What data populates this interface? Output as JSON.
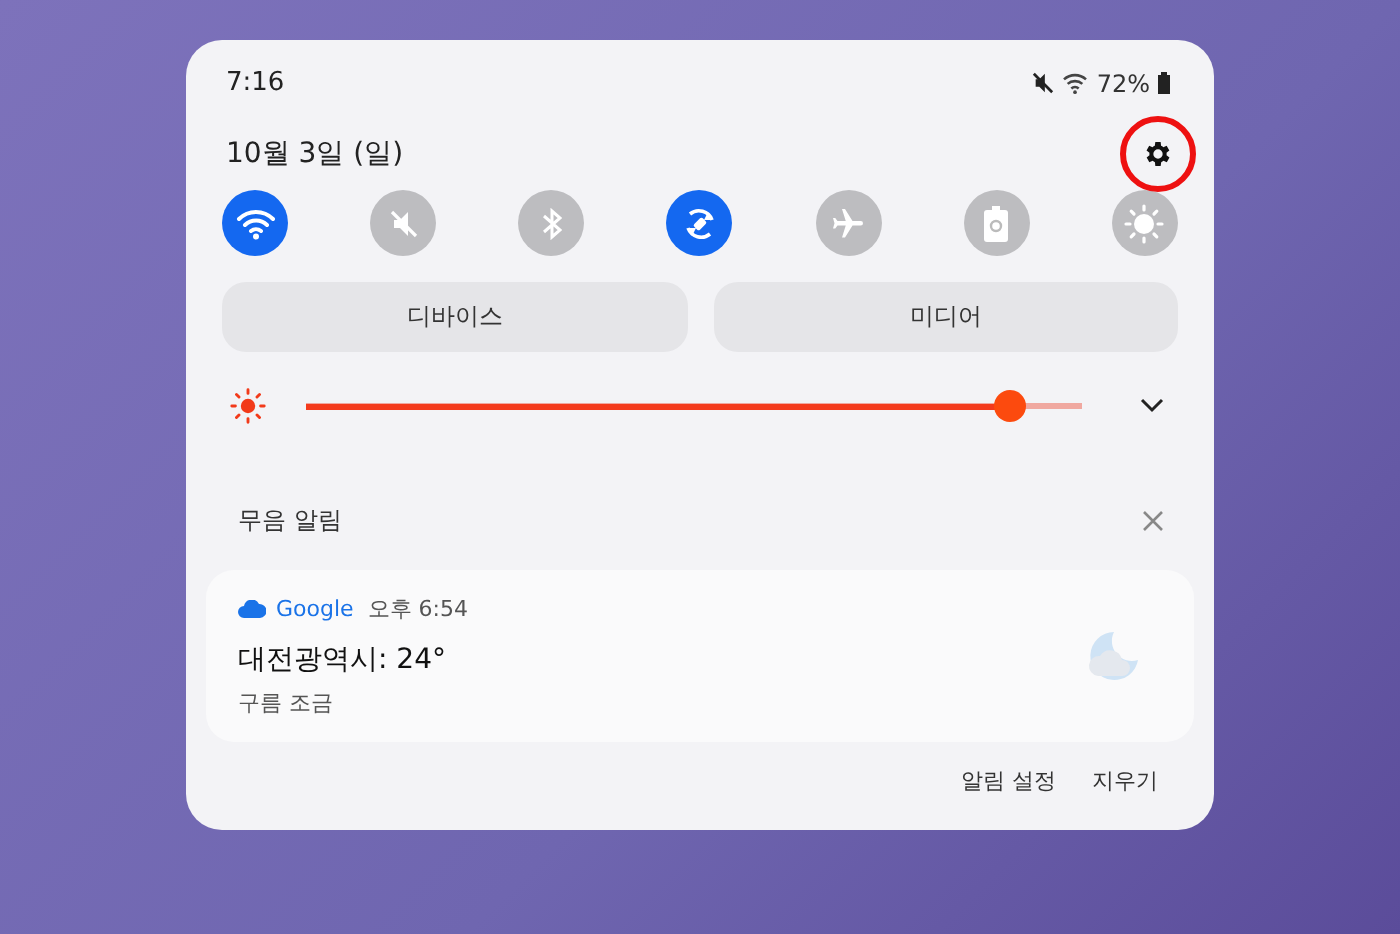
{
  "status_bar": {
    "time": "7:16",
    "battery": "72%"
  },
  "header": {
    "date": "10월 3일 (일)",
    "settings_highlighted": true
  },
  "quick_toggles": [
    {
      "kind": "wifi",
      "on": true
    },
    {
      "kind": "mute",
      "on": false
    },
    {
      "kind": "bluetooth",
      "on": false
    },
    {
      "kind": "rotate",
      "on": true
    },
    {
      "kind": "airplane",
      "on": false
    },
    {
      "kind": "battery",
      "on": false
    },
    {
      "kind": "brightness",
      "on": false
    }
  ],
  "buttons": [
    "디바이스",
    "미디어"
  ],
  "brightness": {
    "level": 0.906
  },
  "silent_section": {
    "title": "무음 알림"
  },
  "notification": {
    "app": "Google",
    "time": "오후 6:54",
    "title": "대전광역시: 24°",
    "text": "구름 조금"
  },
  "footer_buttons": [
    "알림 설정",
    "지우기"
  ]
}
